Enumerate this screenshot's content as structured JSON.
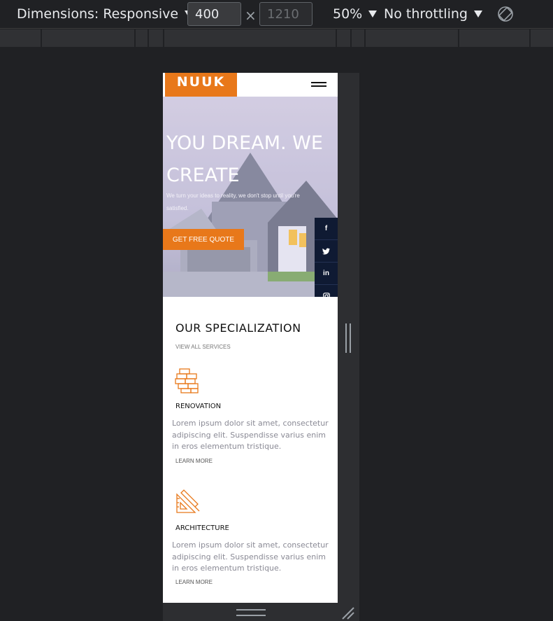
{
  "toolbar": {
    "dimensions_label": "Dimensions: Responsive",
    "width_value": "400",
    "times": "×",
    "height_placeholder": "1210",
    "zoom_label": "50%",
    "throttle_label": "No throttling",
    "rotate_icon": "rotate-icon"
  },
  "page": {
    "logo_text": "NUUK",
    "menu_icon": "hamburger-menu-icon",
    "hero": {
      "title": "YOU DREAM. WE CREATE",
      "subtitle": "We turn your ideas to reality, we don't stop until you're satisfied.",
      "cta_label": "GET FREE QUOTE"
    },
    "social": [
      {
        "icon": "facebook-icon",
        "glyph": "f"
      },
      {
        "icon": "twitter-icon",
        "glyph": "🐦"
      },
      {
        "icon": "linkedin-icon",
        "glyph": "in"
      },
      {
        "icon": "instagram-icon",
        "glyph": "◎"
      }
    ],
    "specialization": {
      "title": "OUR SPECIALIZATION",
      "view_all": "VIEW ALL SERVICES",
      "services": [
        {
          "icon": "bricks-icon",
          "title": "RENOVATION",
          "description": "Lorem ipsum dolor sit amet, consectetur adipiscing elit. Suspendisse varius enim in eros elementum tristique.",
          "learn_more": "LEARN MORE"
        },
        {
          "icon": "ruler-pencil-icon",
          "title": "ARCHITECTURE",
          "description": "Lorem ipsum dolor sit amet, consectetur adipiscing elit. Suspendisse varius enim in eros elementum tristique.",
          "learn_more": "LEARN MORE"
        }
      ]
    }
  },
  "colors": {
    "accent": "#e8781a",
    "social_bg": "#0f1a33",
    "devtools_bg": "#202124"
  }
}
